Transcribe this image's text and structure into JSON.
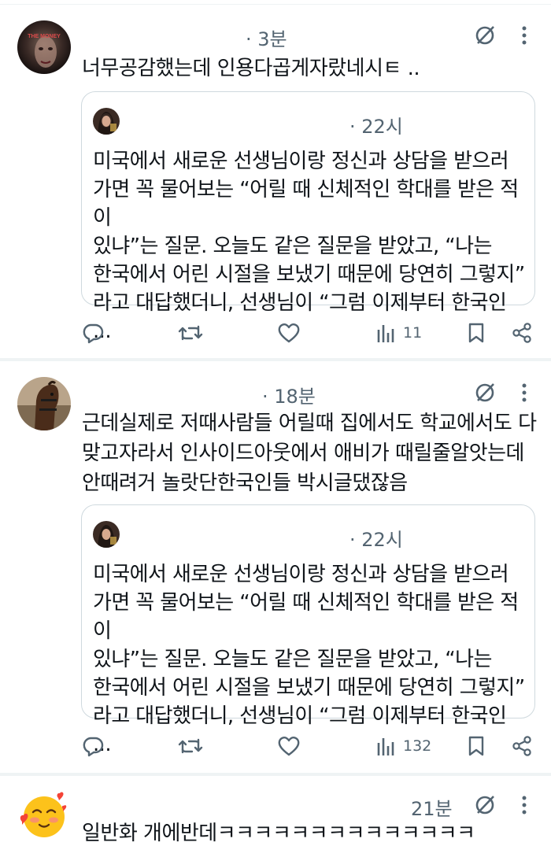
{
  "posts": [
    {
      "time": "· 3분",
      "text": "너무공감했는데 인용다곱게자랐네시ㅌ ..",
      "quote": {
        "time": "· 22시",
        "text": "미국에서 새로운 선생님이랑 정신과 상담을 받으러\n가면 꼭 물어보는 “어릴 때 신체적인 학대를 받은 적이\n있냐”는 질문. 오늘도 같은 질문을 받았고, “나는\n한국에서 어린 시절을 보냈기 때문에 당연히 그렇지”\n라고 대답했더니, 선생님이 “그럼 이제부터 한국인 ..."
      },
      "views": "11"
    },
    {
      "time": "· 18분",
      "text": "근데실제로 저때사람들 어릴때 집에서도 학교에서도 다\n맞고자라서 인사이드아웃에서 애비가 때릴줄알앗는데\n안때려거 놀랏단한국인들 박시글댔잖음",
      "quote": {
        "time": "· 22시",
        "text": "미국에서 새로운 선생님이랑 정신과 상담을 받으러\n가면 꼭 물어보는 “어릴 때 신체적인 학대를 받은 적이\n있냐”는 질문. 오늘도 같은 질문을 받았고, “나는\n한국에서 어린 시절을 보냈기 때문에 당연히 그렇지”\n라고 대답했더니, 선생님이 “그럼 이제부터 한국인 ..."
      },
      "views": "132"
    },
    {
      "time": "21분",
      "text": "일반화 개에반데ㅋㅋㅋㅋㅋㅋㅋㅋㅋㅋㅋㅋㅋㅋ"
    }
  ],
  "avatar1_text": "THE MONEY",
  "icons": [
    "reply-icon",
    "retweet-icon",
    "like-icon",
    "views-icon",
    "bookmark-icon",
    "share-icon",
    "mute-icon",
    "more-icon"
  ],
  "colors": {
    "text": "#0f1419",
    "muted": "#536471",
    "border": "#cfd9de",
    "divider": "#eff3f4"
  }
}
